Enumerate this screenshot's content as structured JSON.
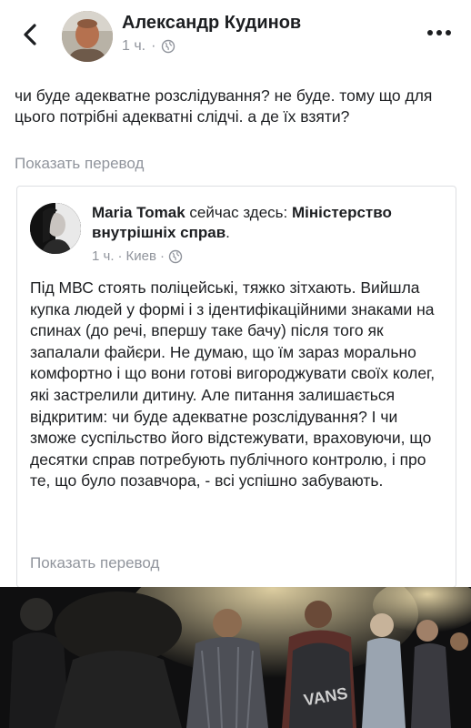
{
  "header": {
    "author": "Александр Кудинов",
    "time": "1 ч.",
    "privacy_icon": "globe-icon",
    "back_icon": "chevron-left-icon",
    "more_icon": "ellipsis-icon"
  },
  "post": {
    "text": "чи буде адекватне розслідування? не буде. тому що для цього потрібні адекватні слідчі. а де їх взяти?",
    "translate_label": "Показать перевод"
  },
  "shared_post": {
    "author": "Maria Tomak",
    "action": " сейчас здесь: ",
    "place": "Міністерство внутрішніх справ",
    "place_suffix": ".",
    "time": "1 ч.",
    "separator": "·",
    "location": "Киев",
    "privacy_icon": "globe-icon",
    "text": "Під МВС стоять поліцейські, тяжко зітхають. Вийшла купка людей у формі і з ідентифікаційними знаками на спинах (до речі, впершу таке бачу) після того як запалали файєри. Не думаю, що їм зараз морально комфортно і що вони готові вигороджувати своїх колег, які застрелили дитину. Але питання залишається відкритим: чи буде адекватне розслідування? І чи зможе суспільство його відстежувати, враховуючи, що десятки справ потребують публічного контролю, і про те, що було позавчора, - всі успішно забувають.",
    "translate_label": "Показать перевод"
  },
  "photo": {
    "backpack_text": "VANS"
  },
  "colors": {
    "text": "#1c1e21",
    "secondary": "#90949c",
    "border": "#dddfe2"
  }
}
